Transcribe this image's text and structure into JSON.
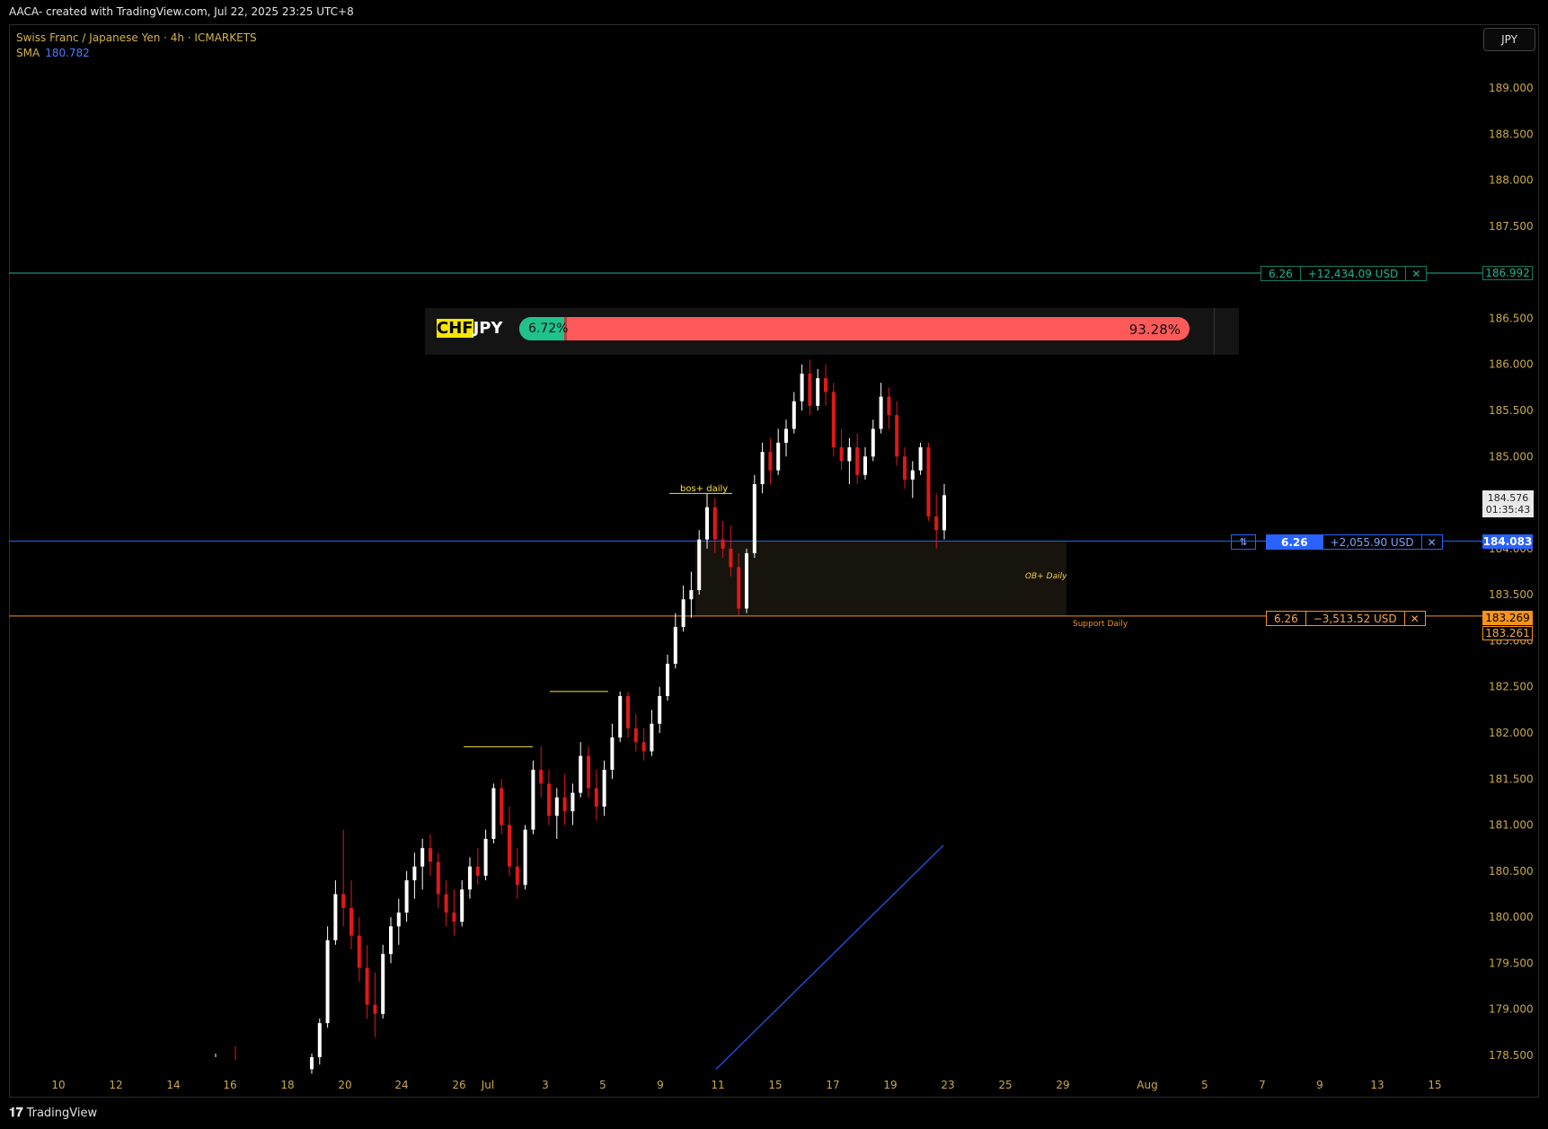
{
  "header": {
    "title": "AACA- created with TradingView.com, Jul 22, 2025 23:25 UTC+8"
  },
  "legend": {
    "symbol_line": "Swiss Franc / Japanese Yen · 4h · ICMARKETS",
    "sma_label": "SMA",
    "sma_value": "180.782"
  },
  "currency_button": "JPY",
  "sentiment": {
    "symbol_base": "CHF",
    "symbol_quote": "JPY",
    "long_pct": "6.72%",
    "short_pct": "93.28%",
    "long_fraction": 0.0672
  },
  "positions": {
    "take_profit": {
      "qty": "6.26",
      "pnl": "+12,434.09 USD",
      "close": "✕",
      "price": "186.992"
    },
    "entry": {
      "reverse": "⇅",
      "qty": "6.26",
      "pnl": "+2,055.90 USD",
      "close": "✕",
      "price": "184.083"
    },
    "stop_loss": {
      "qty": "6.26",
      "pnl": "−3,513.52 USD",
      "close": "✕",
      "price": "183.269",
      "price2": "183.261"
    }
  },
  "last_price": {
    "price": "184.576",
    "countdown": "01:35:43"
  },
  "annotations": {
    "bos": "bos+ daily",
    "ob": "OB+ Daily",
    "support": "Support Daily"
  },
  "footer": {
    "brand": "TradingView",
    "brand_mark": "𝟏𝟕"
  },
  "colors": {
    "up": "#ffffff",
    "down": "#e01818",
    "tp": "#1fb392",
    "entry": "#2962ff",
    "sl": "#f7931a",
    "ob_zone": "#16140c",
    "axis_text": "#c8a94a"
  },
  "chart_data": {
    "type": "candlestick",
    "title": "Swiss Franc / Japanese Yen · 4h · ICMARKETS",
    "yticks": [
      "178.500",
      "179.000",
      "179.500",
      "180.000",
      "180.500",
      "181.000",
      "181.500",
      "182.000",
      "182.500",
      "183.000",
      "183.500",
      "184.000",
      "184.500",
      "185.000",
      "185.500",
      "186.000",
      "186.500",
      "187.000",
      "187.500",
      "188.000",
      "188.500",
      "189.000"
    ],
    "xticks": [
      "10",
      "12",
      "14",
      "16",
      "18",
      "20",
      "24",
      "26",
      "Jul",
      "3",
      "5",
      "9",
      "11",
      "15",
      "17",
      "19",
      "23",
      "25",
      "29",
      "Aug",
      "5",
      "7",
      "9",
      "13",
      "15"
    ],
    "ylim": [
      178.3,
      189.4
    ],
    "horizontal_lines": [
      {
        "name": "take-profit",
        "price": 186.992
      },
      {
        "name": "entry",
        "price": 184.083
      },
      {
        "name": "stop-loss",
        "price": 183.269
      }
    ],
    "ob_zone": {
      "from": "Jul 10",
      "to": "Jul 29",
      "top": 184.083,
      "bottom": 183.269
    },
    "sma_line": [
      {
        "date": "Jul 11",
        "price": 178.35
      },
      {
        "date": "Jul 22",
        "price": 180.78
      }
    ],
    "candles": [
      [
        178.35,
        178.52,
        178.3,
        178.48
      ],
      [
        178.48,
        178.9,
        178.4,
        178.85
      ],
      [
        178.85,
        179.9,
        178.8,
        179.75
      ],
      [
        179.75,
        180.4,
        179.7,
        180.25
      ],
      [
        180.25,
        180.95,
        179.9,
        180.1
      ],
      [
        180.1,
        180.4,
        179.65,
        179.8
      ],
      [
        179.8,
        180.0,
        179.3,
        179.45
      ],
      [
        179.45,
        179.7,
        178.9,
        179.05
      ],
      [
        179.05,
        179.4,
        178.7,
        178.95
      ],
      [
        178.95,
        179.7,
        178.9,
        179.6
      ],
      [
        179.6,
        180.0,
        179.5,
        179.9
      ],
      [
        179.9,
        180.2,
        179.7,
        180.05
      ],
      [
        180.05,
        180.5,
        179.95,
        180.4
      ],
      [
        180.4,
        180.7,
        180.2,
        180.55
      ],
      [
        180.55,
        180.85,
        180.3,
        180.75
      ],
      [
        180.75,
        180.9,
        180.45,
        180.6
      ],
      [
        180.6,
        180.7,
        180.1,
        180.25
      ],
      [
        180.25,
        180.4,
        179.9,
        180.05
      ],
      [
        180.05,
        180.3,
        179.8,
        179.95
      ],
      [
        179.95,
        180.4,
        179.9,
        180.3
      ],
      [
        180.3,
        180.65,
        180.2,
        180.55
      ],
      [
        180.55,
        180.75,
        180.35,
        180.45
      ],
      [
        180.45,
        180.95,
        180.4,
        180.85
      ],
      [
        180.85,
        181.45,
        180.8,
        181.4
      ],
      [
        181.4,
        181.5,
        180.9,
        181.0
      ],
      [
        181.0,
        181.2,
        180.45,
        180.55
      ],
      [
        180.55,
        180.75,
        180.2,
        180.35
      ],
      [
        180.35,
        181.0,
        180.3,
        180.95
      ],
      [
        180.95,
        181.7,
        180.9,
        181.6
      ],
      [
        181.6,
        181.85,
        181.3,
        181.45
      ],
      [
        181.45,
        181.6,
        181.0,
        181.1
      ],
      [
        181.1,
        181.4,
        180.85,
        181.3
      ],
      [
        181.3,
        181.55,
        181.0,
        181.15
      ],
      [
        181.15,
        181.45,
        181.0,
        181.35
      ],
      [
        181.35,
        181.9,
        181.3,
        181.75
      ],
      [
        181.75,
        181.85,
        181.3,
        181.4
      ],
      [
        181.4,
        181.6,
        181.05,
        181.2
      ],
      [
        181.2,
        181.7,
        181.1,
        181.6
      ],
      [
        181.6,
        182.1,
        181.5,
        181.95
      ],
      [
        181.95,
        182.45,
        181.9,
        182.4
      ],
      [
        182.4,
        182.45,
        181.95,
        182.05
      ],
      [
        182.05,
        182.2,
        181.8,
        181.9
      ],
      [
        181.9,
        182.05,
        181.7,
        181.8
      ],
      [
        181.8,
        182.25,
        181.75,
        182.1
      ],
      [
        182.1,
        182.5,
        182.0,
        182.4
      ],
      [
        182.4,
        182.85,
        182.35,
        182.75
      ],
      [
        182.75,
        183.3,
        182.7,
        183.15
      ],
      [
        183.15,
        183.6,
        183.1,
        183.45
      ],
      [
        183.45,
        183.75,
        183.25,
        183.55
      ],
      [
        183.55,
        184.2,
        183.5,
        184.1
      ],
      [
        184.1,
        184.6,
        184.0,
        184.45
      ],
      [
        184.45,
        184.55,
        183.95,
        184.1
      ],
      [
        184.1,
        184.3,
        183.9,
        184.0
      ],
      [
        184.0,
        184.25,
        183.7,
        183.8
      ],
      [
        183.8,
        183.95,
        183.27,
        183.35
      ],
      [
        183.35,
        184.0,
        183.3,
        183.95
      ],
      [
        183.95,
        184.8,
        183.9,
        184.7
      ],
      [
        184.7,
        185.15,
        184.6,
        185.05
      ],
      [
        185.05,
        185.2,
        184.7,
        184.85
      ],
      [
        184.85,
        185.3,
        184.8,
        185.15
      ],
      [
        185.15,
        185.4,
        185.0,
        185.3
      ],
      [
        185.3,
        185.7,
        185.25,
        185.6
      ],
      [
        185.6,
        186.0,
        185.5,
        185.9
      ],
      [
        185.9,
        186.05,
        185.45,
        185.55
      ],
      [
        185.55,
        185.95,
        185.5,
        185.85
      ],
      [
        185.85,
        186.0,
        185.55,
        185.7
      ],
      [
        185.7,
        185.8,
        185.0,
        185.1
      ],
      [
        185.1,
        185.3,
        184.85,
        184.95
      ],
      [
        184.95,
        185.2,
        184.7,
        185.1
      ],
      [
        185.1,
        185.25,
        184.7,
        184.8
      ],
      [
        184.8,
        185.1,
        184.75,
        185.0
      ],
      [
        185.0,
        185.4,
        184.95,
        185.3
      ],
      [
        185.3,
        185.8,
        185.25,
        185.65
      ],
      [
        185.65,
        185.75,
        185.3,
        185.45
      ],
      [
        185.45,
        185.6,
        184.9,
        185.0
      ],
      [
        185.0,
        185.1,
        184.65,
        184.75
      ],
      [
        184.75,
        184.95,
        184.55,
        184.85
      ],
      [
        184.85,
        185.15,
        184.8,
        185.1
      ],
      [
        185.1,
        185.15,
        184.3,
        184.35
      ],
      [
        184.35,
        184.6,
        184.0,
        184.2
      ],
      [
        184.2,
        184.7,
        184.1,
        184.58
      ]
    ]
  }
}
